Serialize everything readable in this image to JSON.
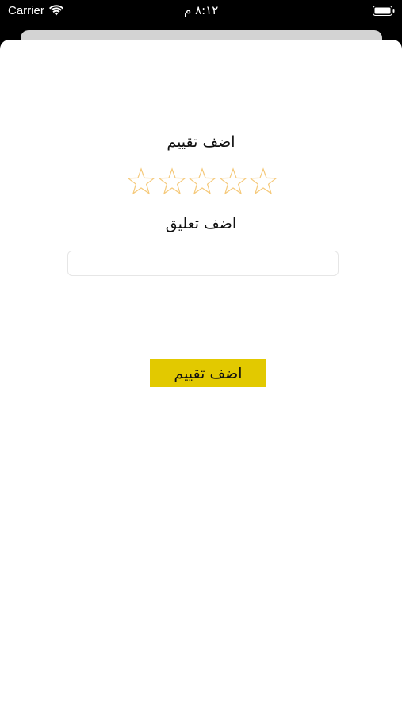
{
  "status_bar": {
    "carrier": "Carrier",
    "time": "٨:١٢ م"
  },
  "rating": {
    "title": "اضف تقييم",
    "value": 0,
    "max": 5,
    "star_color": "#f5c97a"
  },
  "comment": {
    "title": "اضف تعليق",
    "value": "",
    "placeholder": ""
  },
  "submit": {
    "label": "اضف تقييم",
    "color": "#e2c900"
  },
  "icons": [
    "wifi-icon",
    "battery-icon",
    "star-icon"
  ]
}
